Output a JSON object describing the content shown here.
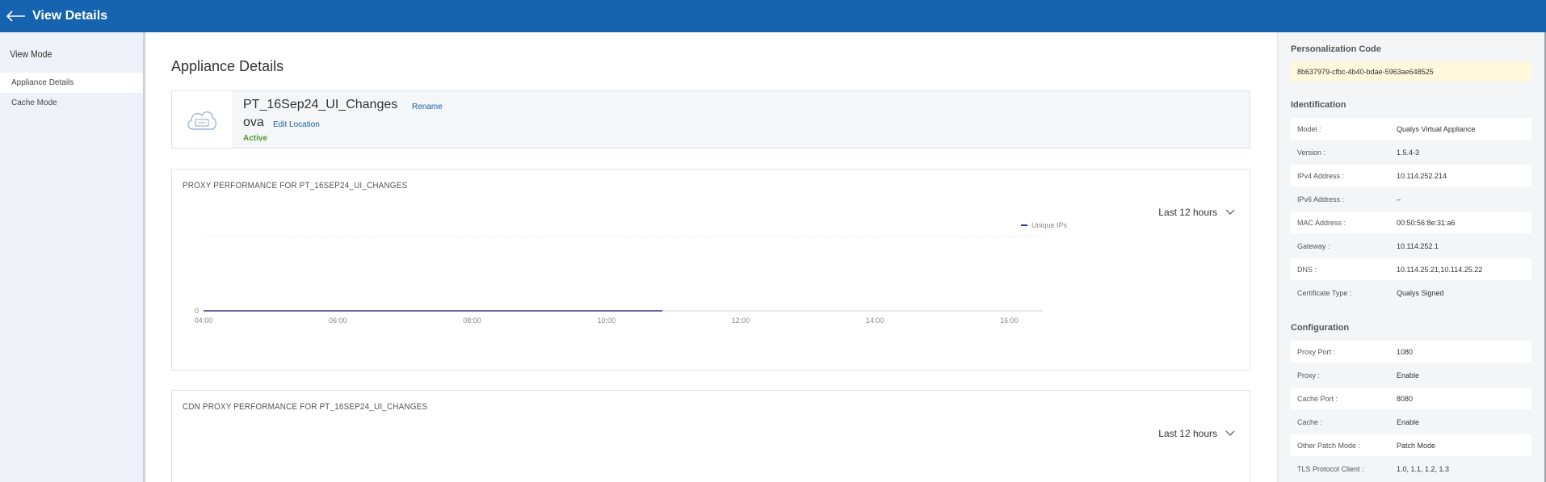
{
  "header": {
    "title": "View Details",
    "back_icon": "arrow-left-icon"
  },
  "sidebar": {
    "heading": "View Mode",
    "items": [
      {
        "label": "Appliance Details",
        "active": true
      },
      {
        "label": "Cache Mode",
        "active": false
      }
    ]
  },
  "main": {
    "title": "Appliance Details",
    "appliance": {
      "name": "PT_16Sep24_UI_Changes",
      "rename_label": "Rename",
      "type": "ova",
      "edit_location_label": "Edit Location",
      "status": "Active",
      "icon": "cloud-appliance-icon"
    },
    "charts": [
      {
        "title": "PROXY PERFORMANCE FOR PT_16SEP24_UI_CHANGES",
        "range": "Last 12 hours"
      },
      {
        "title": "CDN PROXY PERFORMANCE FOR PT_16SEP24_UI_CHANGES",
        "range": "Last 12 hours"
      }
    ]
  },
  "chart_data": {
    "type": "line",
    "series": [
      {
        "name": "Unique IPs",
        "values": [
          0,
          0,
          0,
          0,
          0
        ]
      }
    ],
    "x": [
      "04:00",
      "06:00",
      "08:00",
      "10:00",
      "10:50"
    ],
    "x_ticks": [
      "04:00",
      "06:00",
      "08:00",
      "10:00",
      "12:00",
      "14:00",
      "16:00"
    ],
    "y_ticks": [
      "0"
    ],
    "series_color": "#2b3a8c"
  },
  "right_panel": {
    "personalization": {
      "title": "Personalization Code",
      "code": "8b637979-cfbc-4b40-bdae-5963ae648525"
    },
    "identification": {
      "title": "Identification",
      "rows": [
        {
          "key": "Model :",
          "value": "Qualys Virtual Appliance"
        },
        {
          "key": "Version :",
          "value": "1.5.4-3"
        },
        {
          "key": "IPv4 Address :",
          "value": "10.114.252.214"
        },
        {
          "key": "IPv6 Address :",
          "value": "–"
        },
        {
          "key": "MAC Address :",
          "value": "00:50:56:8e:31:a6"
        },
        {
          "key": "Gateway :",
          "value": "10.114.252.1"
        },
        {
          "key": "DNS :",
          "value": "10.114.25.21,10.114.25.22"
        },
        {
          "key": "Certificate Type :",
          "value": "Qualys Signed"
        }
      ]
    },
    "configuration": {
      "title": "Configuration",
      "rows": [
        {
          "key": "Proxy Port :",
          "value": "1080"
        },
        {
          "key": "Proxy :",
          "value": "Enable"
        },
        {
          "key": "Cache Port :",
          "value": "8080"
        },
        {
          "key": "Cache :",
          "value": "Enable"
        },
        {
          "key": "Other Patch Mode :",
          "value": "Patch Mode"
        },
        {
          "key": "TLS Protocol Client :",
          "value": "1.0, 1.1, 1.2, 1.3"
        }
      ]
    }
  },
  "colors": {
    "header_bg": "#1664b0",
    "status_active": "#4d9a2a",
    "link": "#1a5fa8"
  }
}
